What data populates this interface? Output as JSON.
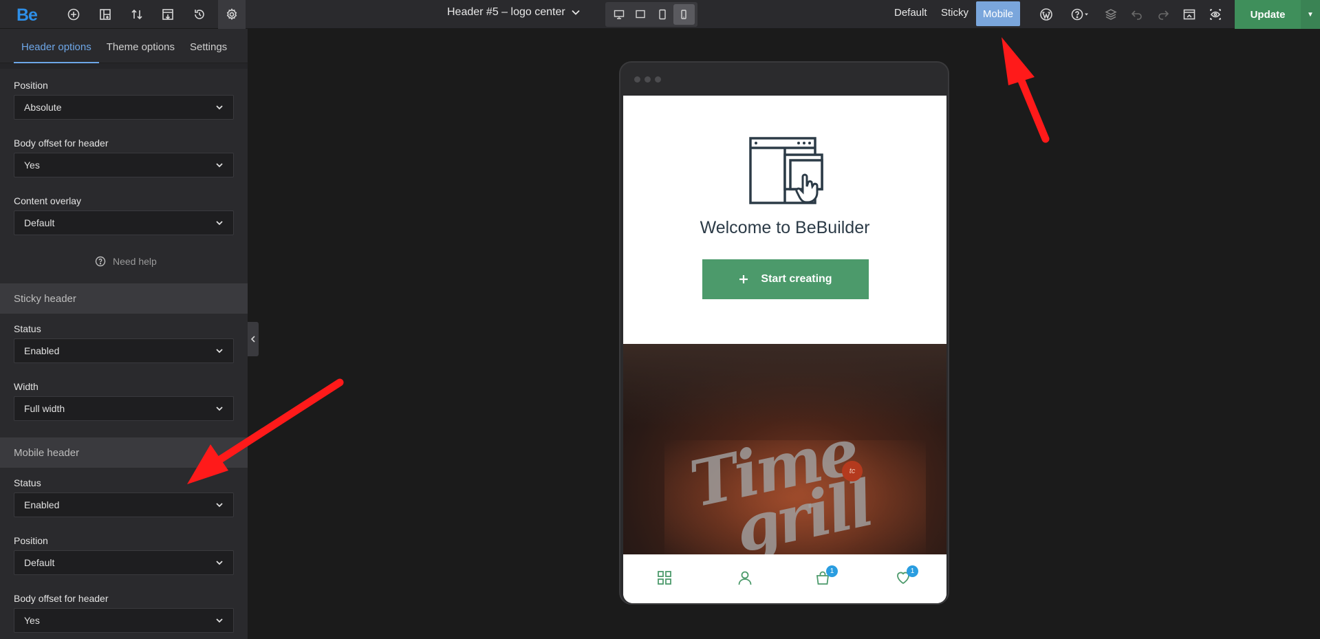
{
  "app": {
    "logo": "Be"
  },
  "toolbar": {
    "document_title": "Header #5 – logo center",
    "modes": {
      "default": "Default",
      "sticky": "Sticky",
      "mobile": "Mobile"
    },
    "update_label": "Update"
  },
  "sidebar": {
    "tabs": [
      "Header options",
      "Theme options",
      "Settings"
    ],
    "fields": {
      "position_label": "Position",
      "position_value": "Absolute",
      "body_offset_label": "Body offset for header",
      "body_offset_value": "Yes",
      "content_overlay_label": "Content overlay",
      "content_overlay_value": "Default"
    },
    "help_label": "Need help",
    "sticky": {
      "title": "Sticky header",
      "status_label": "Status",
      "status_value": "Enabled",
      "width_label": "Width",
      "width_value": "Full width"
    },
    "mobile": {
      "title": "Mobile header",
      "status_label": "Status",
      "status_value": "Enabled",
      "position_label": "Position",
      "position_value": "Default",
      "body_offset_label": "Body offset for header",
      "body_offset_value": "Yes"
    }
  },
  "preview": {
    "welcome": "Welcome to BeBuilder",
    "start_label": "Start creating",
    "hero_logo_line1": "Time",
    "hero_logo_line2": "grill",
    "hero_badge": "tc",
    "cart_count": "1",
    "wishlist_count": "1"
  },
  "colors": {
    "accent": "#6ea7e8",
    "update": "#3f8f5b",
    "mobile_mode": "#7aa6dc",
    "annotation": "#ff1a1a"
  }
}
